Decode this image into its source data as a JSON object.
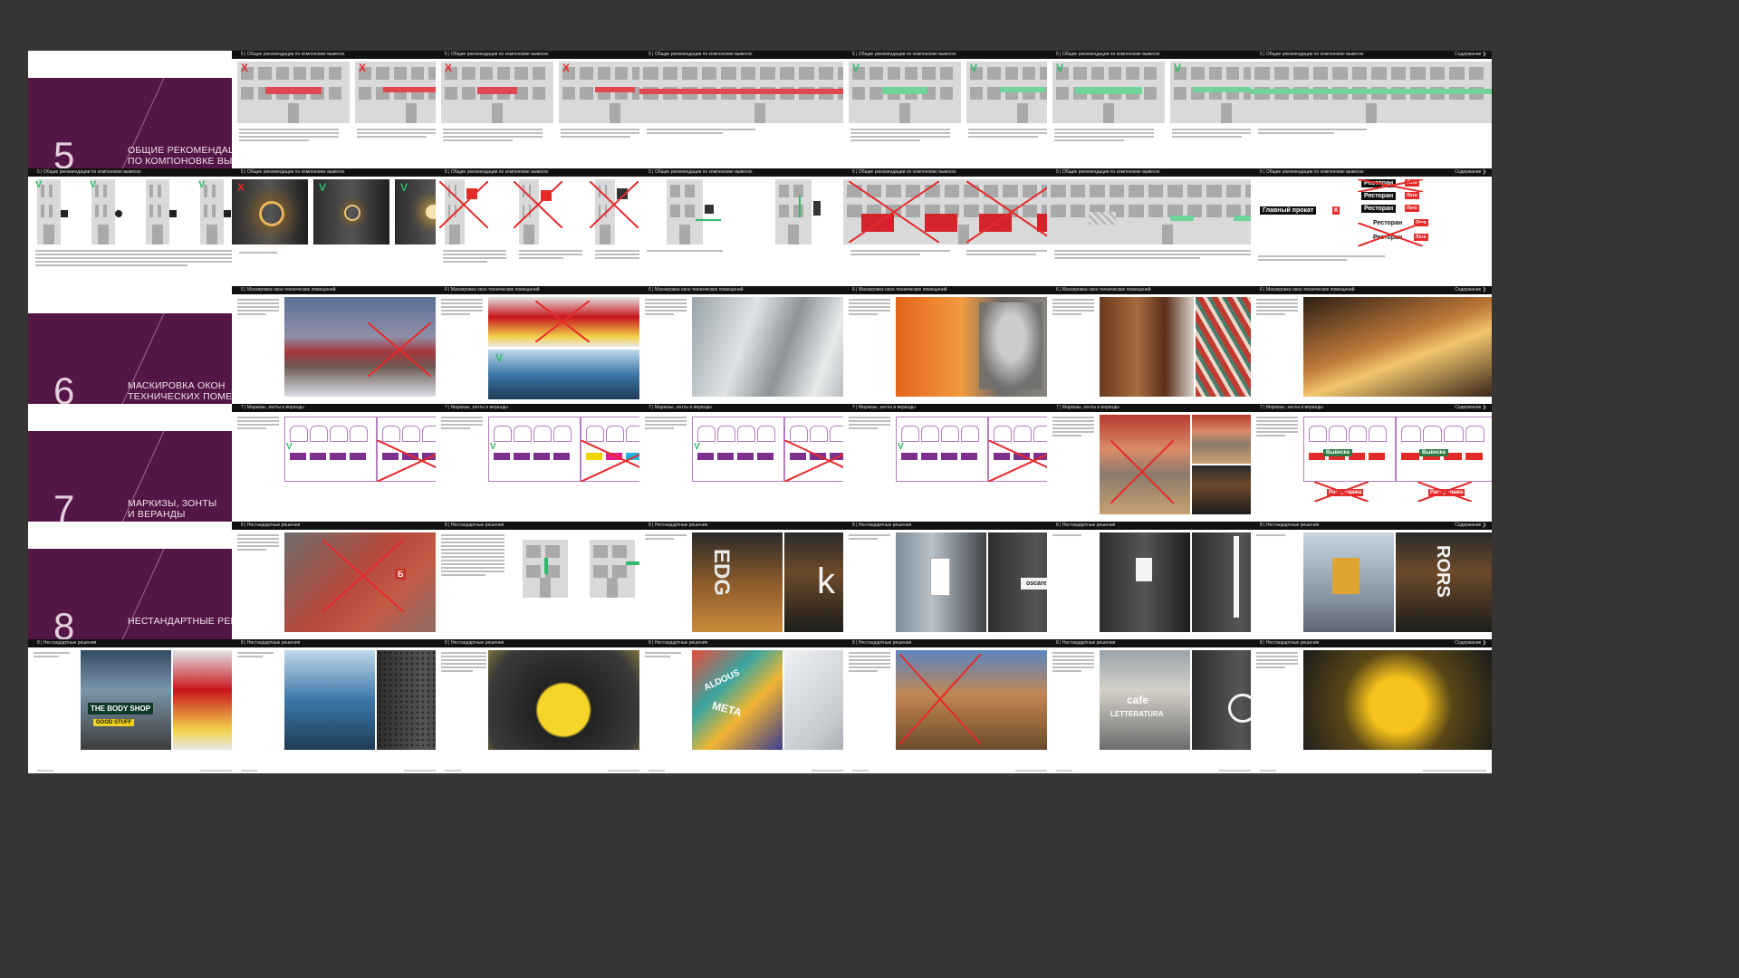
{
  "covers": [
    {
      "number": "5",
      "title_line1": "ОБЩИЕ РЕКОМЕНДАЦИИ",
      "title_line2": "ПО КОМПОНОВКЕ ВЫВЕСОК"
    },
    {
      "number": "6",
      "title_line1": "МАСКИРОВКА ОКОН",
      "title_line2": "ТЕХНИЧЕСКИХ ПОМЕЩЕНИЙ"
    },
    {
      "number": "7",
      "title_line1": "МАРКИЗЫ, ЗОНТЫ",
      "title_line2": "И ВЕРАНДЫ"
    },
    {
      "number": "8",
      "title_line1": "НЕСТАНДАРТНЫЕ РЕШЕНИЯ",
      "title_line2": ""
    }
  ],
  "section_headers": {
    "s5": "5 | Общие рекомендации по компоновке вывесок",
    "s6": "6 | Маскировка окон технических помещений",
    "s7": "7 | Маркизы, зонты и веранды",
    "s8": "8 | Нестандартные решения"
  },
  "header_right": "Содержание ❯",
  "sign_labels": {
    "main": "Главный прокат",
    "main_badge": "К",
    "restaurant": "Ресторан",
    "restaurant_badge": "Лого",
    "vyveska": "Вывеска",
    "rasprodazha": "Распродажа"
  },
  "photo_labels": {
    "body_shop": "THE BODY SHOP",
    "good_stuff": "GOOD STUFF",
    "oscare": "oscare",
    "k_letter": "k",
    "edg": "EDG",
    "rors": "RORS",
    "cafe": "cafe",
    "letteratura": "LETTERATURA",
    "aldous": "ALDOUS",
    "meta": "META",
    "sign_b": "Б"
  },
  "marks": {
    "cross": "X",
    "check": "V"
  },
  "colors": {
    "background": "#363534",
    "cover": "#541646",
    "accent_red": "#e52a2a",
    "accent_green": "#2dbb6a",
    "marquise_purple": "#8e2f9a"
  }
}
